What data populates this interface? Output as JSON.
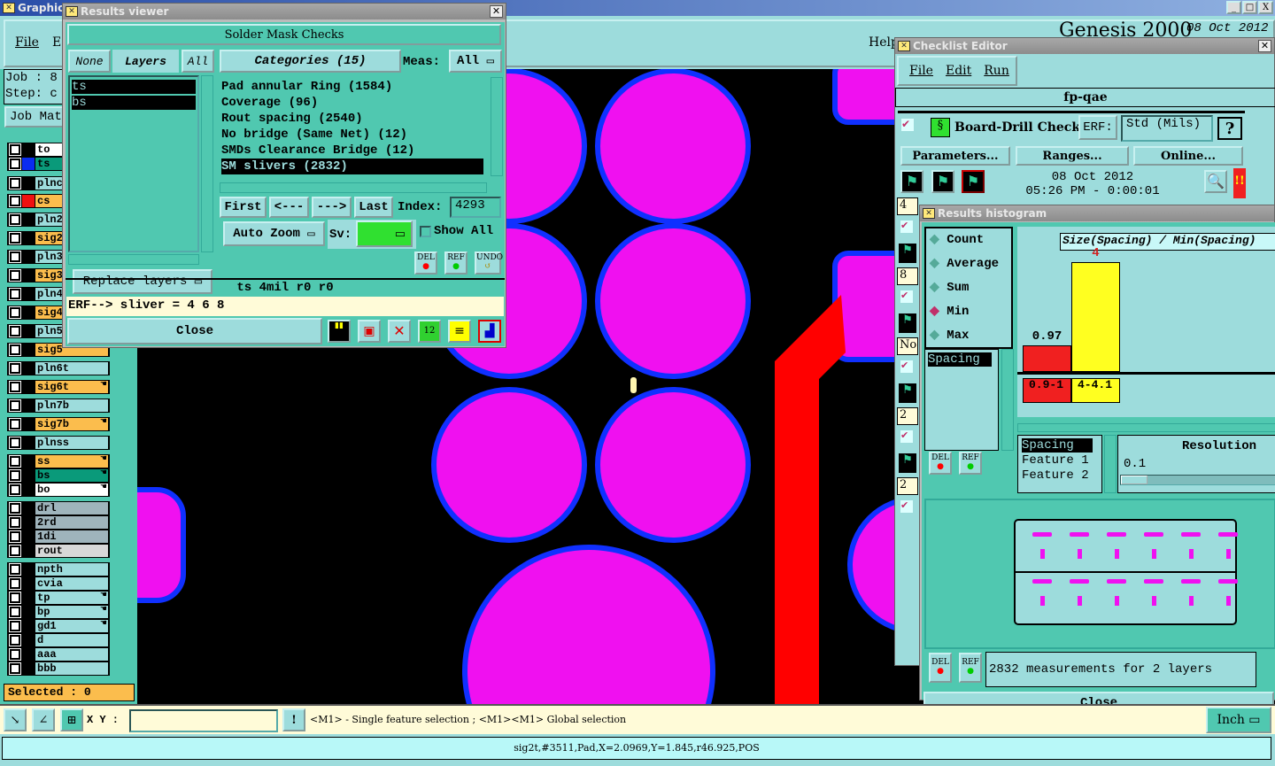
{
  "main_window": {
    "title": "Graphic E",
    "menu": [
      "File",
      "Ed"
    ],
    "help": "Help",
    "brand": "Genesis 2000",
    "date": "08 Oct 2012",
    "job_label": "Job  :  8",
    "step_label": "Step:  c",
    "job_matrix": "Job Mat",
    "selected": "Selected : 0",
    "layers": [
      {
        "name": "to",
        "color": "#ffffff"
      },
      {
        "name": "ts",
        "color": "#0a9a7a",
        "swatch": "#0a2cf0"
      },
      {
        "name": "plnc",
        "color": "#9ddcdc"
      },
      {
        "name": "cs",
        "color": "#fbbd4d",
        "swatch": "#f01010"
      },
      {
        "name": "pln2",
        "color": "#9ddcdc"
      },
      {
        "name": "sig2",
        "color": "#fbbd4d"
      },
      {
        "name": "pln3",
        "color": "#9ddcdc"
      },
      {
        "name": "sig3",
        "color": "#fbbd4d"
      },
      {
        "name": "pln4",
        "color": "#9ddcdc"
      },
      {
        "name": "sig4",
        "color": "#fbbd4d"
      },
      {
        "name": "pln5",
        "color": "#9ddcdc"
      },
      {
        "name": "sig5",
        "color": "#fbbd4d"
      },
      {
        "name": "pln6t",
        "color": "#9ddcdc"
      },
      {
        "name": "sig6t",
        "color": "#fbbd4d",
        "hand": true
      },
      {
        "name": "pln7b",
        "color": "#9ddcdc"
      },
      {
        "name": "sig7b",
        "color": "#fbbd4d",
        "hand": true
      },
      {
        "name": "plnss",
        "color": "#9ddcdc"
      },
      {
        "name": "ss",
        "color": "#fbbd4d",
        "hand": true
      },
      {
        "name": "bs",
        "color": "#0a9a7a",
        "hand": true
      },
      {
        "name": "bo",
        "color": "#ffffff",
        "hand": true
      },
      {
        "name": "drl",
        "color": "#9fb4bc"
      },
      {
        "name": "2rd",
        "color": "#9fb4bc"
      },
      {
        "name": "1di",
        "color": "#9fb4bc"
      },
      {
        "name": "rout",
        "color": "#d8d8d8"
      },
      {
        "name": "npth",
        "color": "#9ddcdc"
      },
      {
        "name": "cvia",
        "color": "#9ddcdc"
      },
      {
        "name": "tp",
        "color": "#9ddcdc",
        "hand": true
      },
      {
        "name": "bp",
        "color": "#9ddcdc",
        "hand": true
      },
      {
        "name": "gd1",
        "color": "#9ddcdc",
        "hand": true
      },
      {
        "name": "d",
        "color": "#9ddcdc"
      },
      {
        "name": "aaa",
        "color": "#9ddcdc"
      },
      {
        "name": "bbb",
        "color": "#9ddcdc"
      }
    ],
    "xy_label": "X Y :",
    "xy_value": "",
    "prompt": "<M1> - Single feature selection ; <M1><M1> Global selection",
    "units": "Inch",
    "status": "sig2t,#3511,Pad,X=2.0969,Y=1.845,r46.925,POS",
    "window_controls": [
      "_",
      "□",
      "X"
    ]
  },
  "results_viewer": {
    "title": "Results viewer",
    "heading": "Solder Mask Checks",
    "none": "None",
    "layers_label": "Layers",
    "all": "All",
    "layers": [
      "ts",
      "bs"
    ],
    "categories_label": "Categories (15)",
    "meas_label": "Meas:",
    "meas_value": "All",
    "categories": [
      "Pad annular Ring (1584)",
      "Coverage (96)",
      "Rout spacing (2540)",
      "No bridge (Same Net) (12)",
      "SMDs Clearance Bridge (12)",
      "SM slivers (2832)"
    ],
    "selected_category": "SM slivers (2832)",
    "nav": {
      "first": "First",
      "prev": "<---",
      "next": "--->",
      "last": "Last",
      "index_label": "Index:",
      "index_value": "4293"
    },
    "auto_zoom": "Auto Zoom",
    "sv_label": "Sv:",
    "show_all": "Show All",
    "replace_layers": "Replace layers",
    "del": "DEL",
    "ref": "REF",
    "undo": "UNDO",
    "info": "ts 4mil   r0   r0",
    "erf": "ERF--> sliver = 4 6 8",
    "close": "Close"
  },
  "checklist_editor": {
    "title": "Checklist Editor",
    "menu": [
      "File",
      "Edit",
      "Run"
    ],
    "name": "fp-qae",
    "check": "Board-Drill Checks",
    "erf_label": "ERF:",
    "erf_value": "Std (Mils)",
    "help": "?",
    "buttons": [
      "Parameters...",
      "Ranges...",
      "Online..."
    ],
    "run_date": "08 Oct 2012",
    "run_time": "05:26 PM - 0:00:01",
    "alert": "!!",
    "side_values": [
      "4",
      "8",
      "No",
      "2",
      "2"
    ]
  },
  "histogram": {
    "title": "Results histogram",
    "modes": [
      "Count",
      "Average",
      "Sum",
      "Min",
      "Max"
    ],
    "selected_mode": "Min",
    "measure_list": [
      "Spacing"
    ],
    "chart_title": "Size(Spacing) / Min(Spacing)",
    "bars": [
      {
        "range": "0.9-1",
        "value": 0.97,
        "label": "0.97",
        "color": "#f02020"
      },
      {
        "range": "4-4.1",
        "value": 4,
        "label": "4",
        "color": "#ffff20"
      }
    ],
    "fields": [
      "Spacing",
      "Feature 1",
      "Feature 2"
    ],
    "resolution_label": "Resolution",
    "resolution_value": "0.1",
    "del": "DEL",
    "ref": "REF",
    "summary": "2832 measurements for 2 layers",
    "close": "Close"
  }
}
